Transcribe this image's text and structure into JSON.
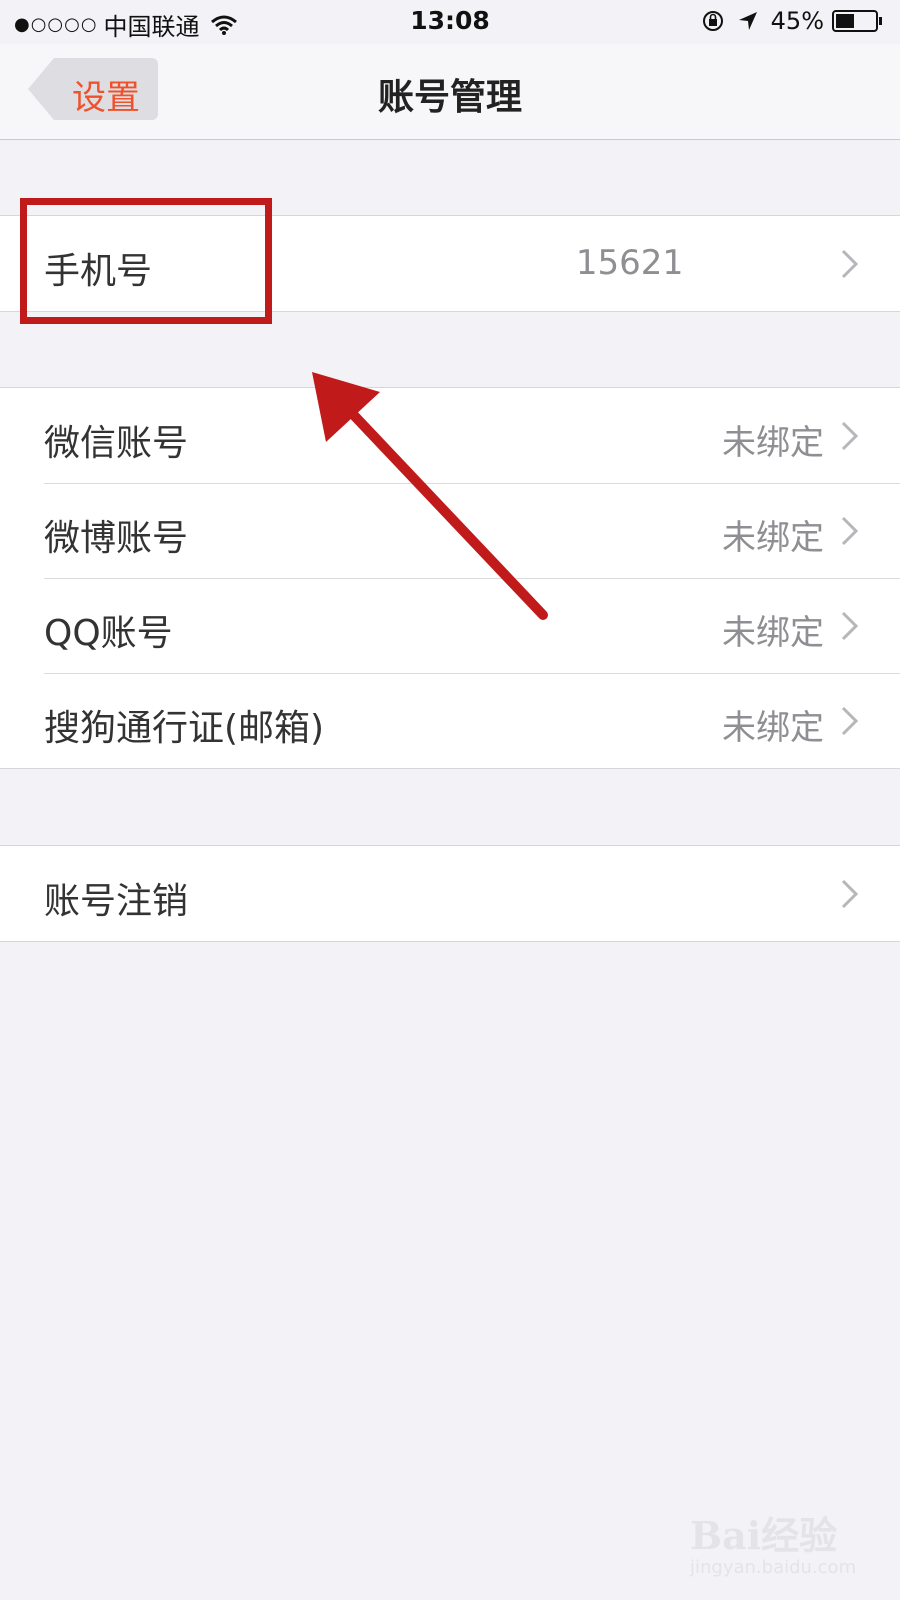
{
  "status_bar": {
    "signal": "●○○○○",
    "carrier": "中国联通",
    "time": "13:08",
    "battery": "45%"
  },
  "nav": {
    "back_label": "设置",
    "title": "账号管理"
  },
  "groups": [
    {
      "rows": [
        {
          "label": "手机号",
          "value": "15621"
        }
      ]
    },
    {
      "rows": [
        {
          "label": "微信账号",
          "value": "未绑定"
        },
        {
          "label": "微博账号",
          "value": "未绑定"
        },
        {
          "label": "QQ账号",
          "value": "未绑定"
        },
        {
          "label": "搜狗通行证(邮箱)",
          "value": "未绑定"
        }
      ]
    },
    {
      "rows": [
        {
          "label": "账号注销",
          "value": ""
        }
      ]
    }
  ],
  "watermark": {
    "logo": "Bai经验",
    "url": "jingyan.baidu.com"
  },
  "colors": {
    "accent": "#f0512b",
    "annotation": "#c11a1a",
    "background": "#f3f3f7"
  }
}
